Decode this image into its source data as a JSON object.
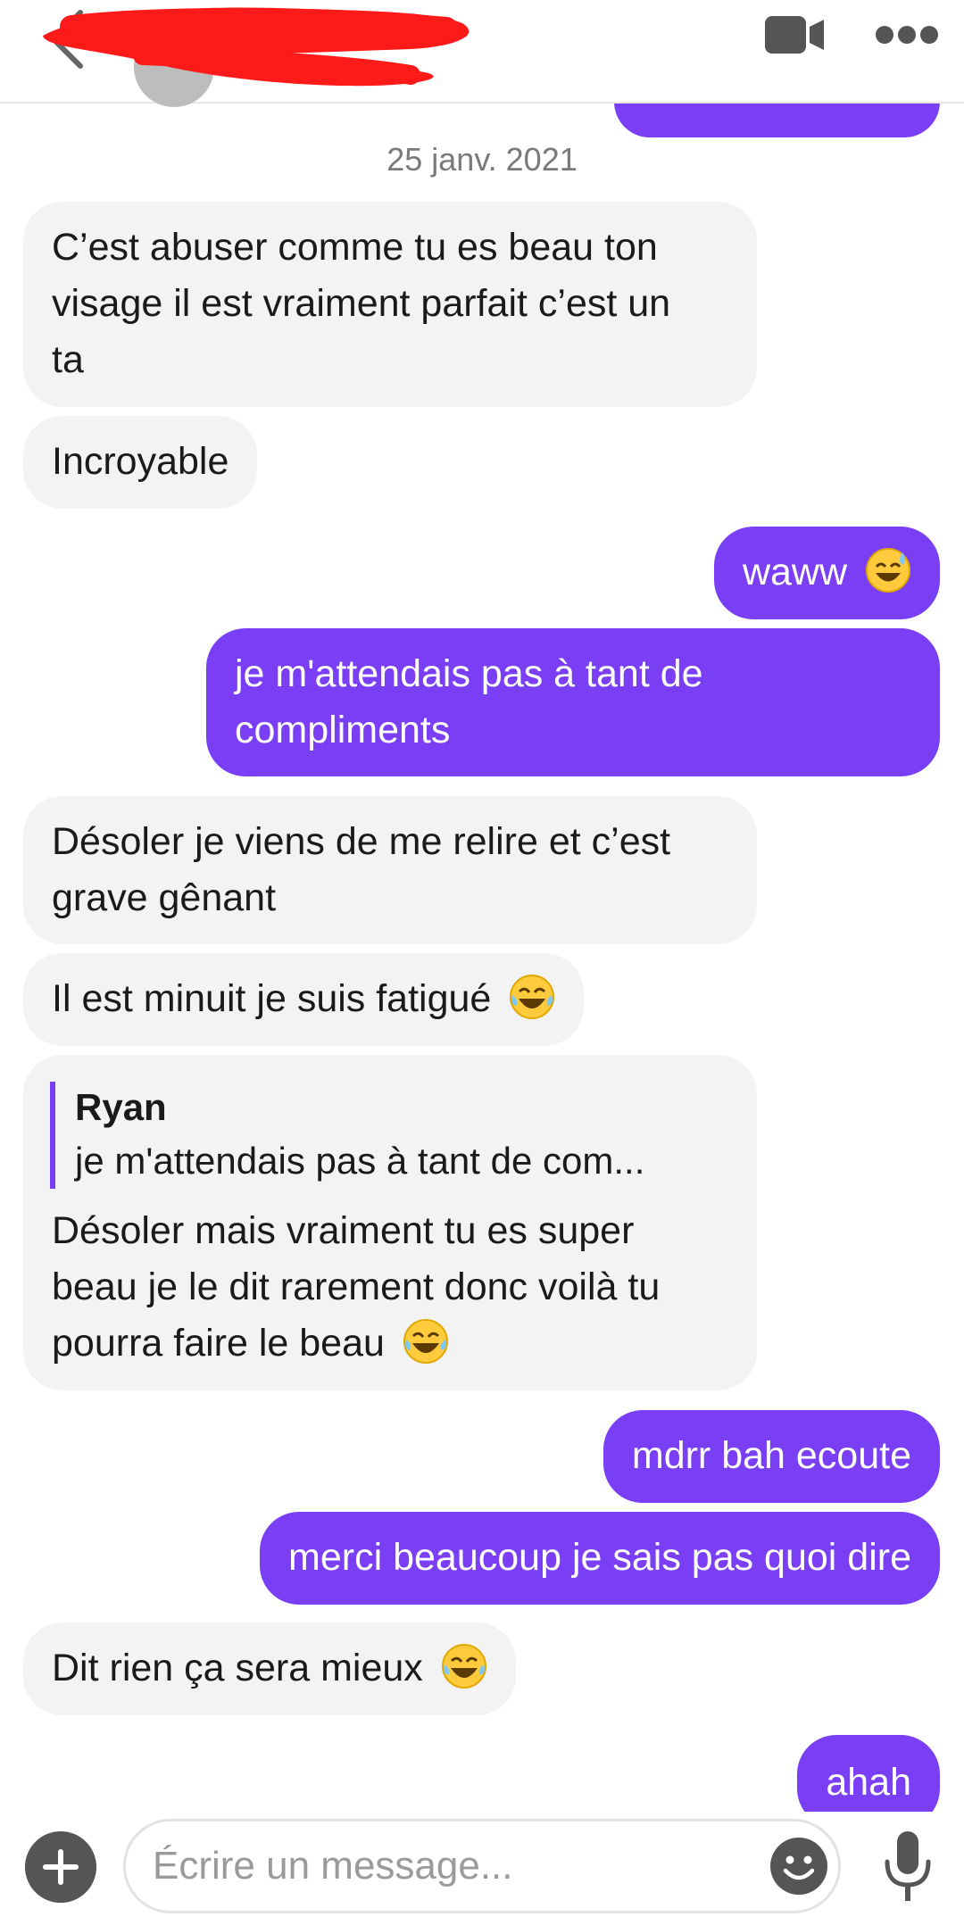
{
  "header": {
    "back_icon": "chevron-left-icon",
    "video_icon": "video-camera-icon",
    "more_icon": "more-horizontal-icon",
    "contact_name_redacted": true
  },
  "colors": {
    "accent": "#7a3ff5",
    "received_bubble": "#f3f3f3",
    "redaction": "#ff1a1a"
  },
  "conversation": {
    "date_separator": "25 janv. 2021",
    "messages": [
      {
        "from": "them",
        "lines": [
          "C’est abuser comme tu es beau ton",
          "visage il est vraiment parfait c’est un",
          "ta"
        ]
      },
      {
        "from": "them",
        "text": "Incroyable"
      },
      {
        "from": "me",
        "text": "waww",
        "emoji": "sweat-smile-emoji"
      },
      {
        "from": "me",
        "lines": [
          "je m'attendais pas à tant de",
          "compliments"
        ]
      },
      {
        "from": "them",
        "lines": [
          "Désoler je viens de me relire et c’est",
          "grave gênant"
        ]
      },
      {
        "from": "them",
        "text": "Il est minuit je suis fatigué",
        "emoji": "joy-emoji"
      },
      {
        "from": "them",
        "quote": {
          "author": "Ryan",
          "text": "je m'attendais pas à tant de com..."
        },
        "lines": [
          "Désoler mais vraiment tu es super",
          "beau je le dit rarement donc voilà tu",
          "pourra faire le beau"
        ],
        "emoji": "joy-emoji"
      },
      {
        "from": "me",
        "text": "mdrr bah ecoute"
      },
      {
        "from": "me",
        "text": "merci beaucoup je sais pas quoi dire"
      },
      {
        "from": "them",
        "text": "Dit rien ça sera mieux",
        "emoji": "joy-emoji"
      },
      {
        "from": "me",
        "text": "ahah"
      }
    ]
  },
  "composer": {
    "placeholder": "Écrire un message...",
    "value": "",
    "plus_icon": "plus-circle-icon",
    "emoji_icon": "smiley-icon",
    "mic_icon": "microphone-icon"
  }
}
